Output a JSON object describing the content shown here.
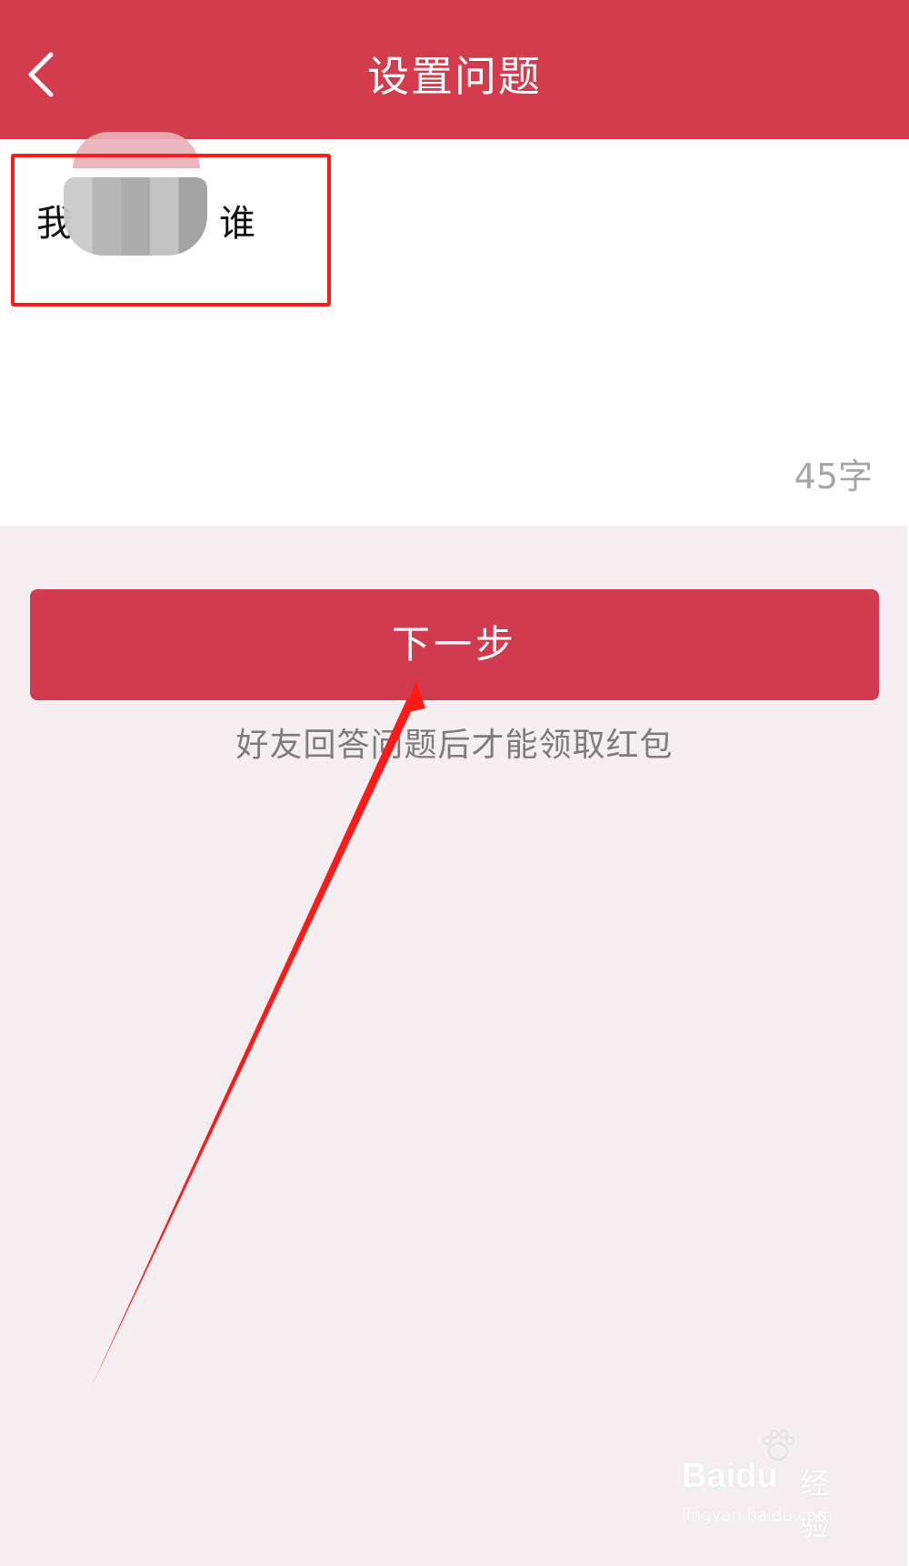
{
  "header": {
    "title": "设置问题",
    "back_icon": "chevron-left-icon"
  },
  "question": {
    "visible_text_start": "我",
    "visible_text_end": "谁",
    "char_count": "45字"
  },
  "actions": {
    "next_label": "下一步",
    "hint": "好友回答问题后才能领取红包"
  },
  "watermark": {
    "brand": "Baidu",
    "product": "经验",
    "url": "jingyan.baidu.com"
  },
  "colors": {
    "header_bg": "#d23c4c",
    "button_bg": "#d03b50",
    "annotation": "#ff1a1a",
    "page_bg": "#f4eef1"
  }
}
